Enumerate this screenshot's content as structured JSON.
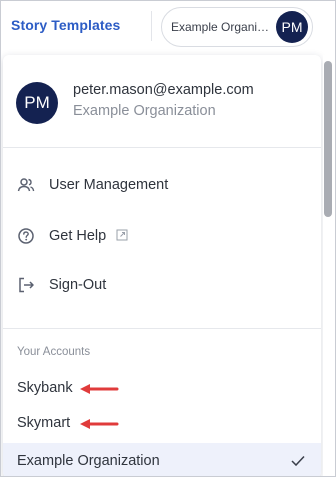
{
  "header": {
    "app_title": "Story Templates",
    "org_name": "Example Organization",
    "avatar_initials": "PM"
  },
  "profile": {
    "initials": "PM",
    "email": "peter.mason@example.com",
    "organization": "Example Organization"
  },
  "menu": {
    "items": [
      {
        "label": "User Management",
        "icon": "users-icon"
      },
      {
        "label": "Get Help",
        "icon": "help-circle-icon",
        "external": true
      },
      {
        "label": "Sign-Out",
        "icon": "sign-out-icon"
      }
    ]
  },
  "accounts": {
    "section_label": "Your Accounts",
    "items": [
      {
        "label": "Skybank",
        "selected": false,
        "annotated_with_arrow": true
      },
      {
        "label": "Skymart",
        "selected": false,
        "annotated_with_arrow": true
      },
      {
        "label": "Example Organization",
        "selected": true
      }
    ]
  },
  "colors": {
    "brand": "#2c5cc5",
    "avatar_bg": "#142251",
    "selected_bg": "#eef1fb",
    "annotation_arrow": "#e03b3b"
  }
}
